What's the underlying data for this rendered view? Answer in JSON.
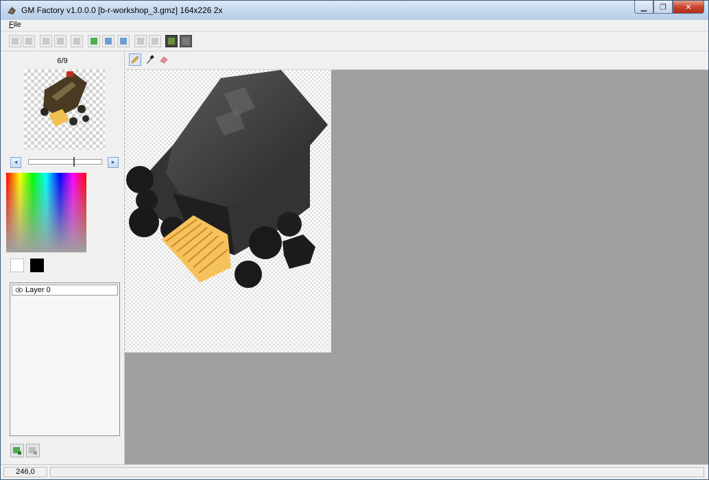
{
  "window": {
    "title": "GM Factory v1.0.0.0 [b-r-workshop_3.gmz] 164x226 2x",
    "minimize_symbol": "▁",
    "restore_symbol": "❐",
    "close_symbol": "✕"
  },
  "menu": {
    "file_first": "F",
    "file_rest": "ile"
  },
  "toolbar": {
    "icons": [
      "new-icon",
      "open-icon",
      "save-icon",
      "save-as-icon",
      "blank-icon",
      "fit-icon",
      "zoom-in-icon",
      "zoom-out-icon",
      "import-icon",
      "export-icon",
      "green-view-icon",
      "gray-view-icon"
    ]
  },
  "frames": {
    "label": "6/9",
    "current": 6,
    "total": 9,
    "prev_symbol": "◂",
    "next_symbol": "▸"
  },
  "colors": {
    "foreground": "#ffffff",
    "background": "#000000"
  },
  "layers": [
    {
      "label": "Layer 0",
      "visible": true
    }
  ],
  "draw_tools": [
    "pencil-icon",
    "eyedropper-icon",
    "eraser-icon"
  ],
  "status": {
    "coords": "246,0"
  }
}
